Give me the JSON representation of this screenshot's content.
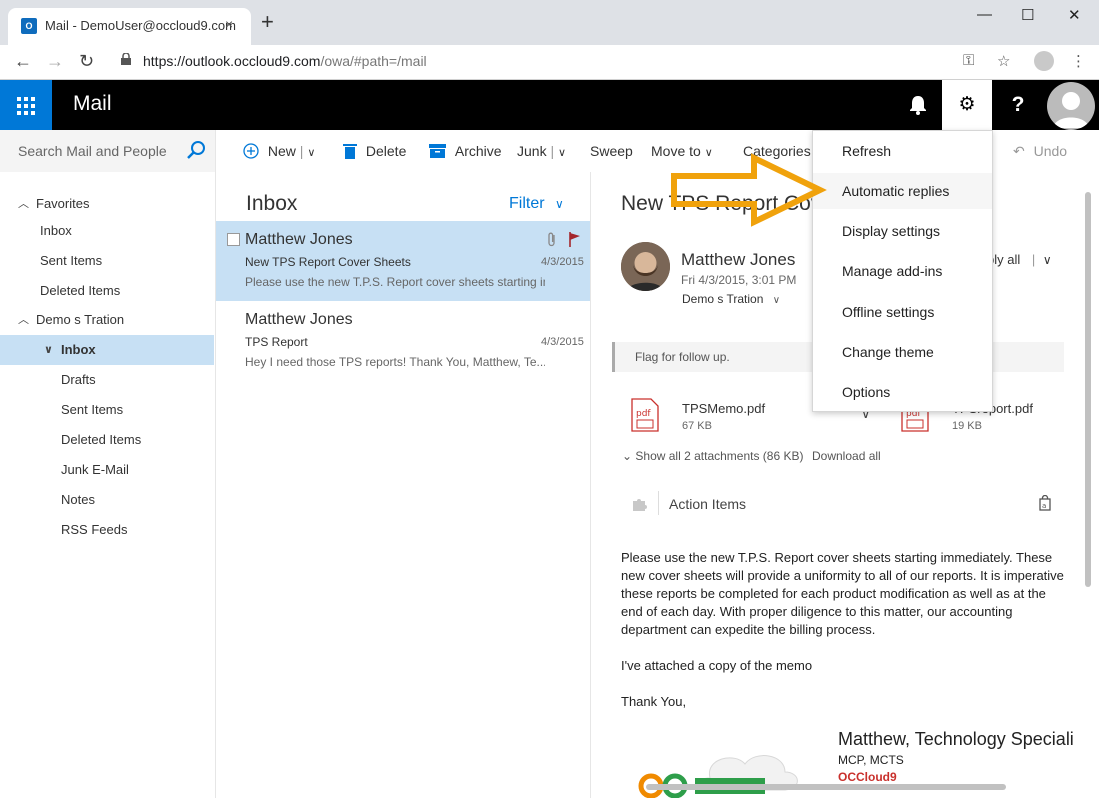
{
  "browser": {
    "tab_title": "Mail - DemoUser@occloud9.com",
    "tab_close": "×",
    "new_tab": "+",
    "favicon_letter": "O",
    "url_host": "https://outlook.occloud9.com",
    "url_path": "/owa/#path=/mail",
    "win_min": "—",
    "win_max": "☐",
    "win_close": "✕",
    "back": "←",
    "forward": "→",
    "reload": "↻",
    "key_icon": "⚿",
    "star_icon": "☆",
    "menu_icon": "⋮"
  },
  "app": {
    "title": "Mail",
    "bell_icon": "🔔",
    "settings_icon": "⚙",
    "help_icon": "?"
  },
  "leftnav": {
    "search_placeholder": "Search Mail and People",
    "favorites_label": "Favorites",
    "favorites": [
      "Inbox",
      "Sent Items",
      "Deleted Items"
    ],
    "account_label": "Demo s Tration",
    "folders": [
      "Inbox",
      "Drafts",
      "Sent Items",
      "Deleted Items",
      "Junk E-Mail",
      "Notes",
      "RSS Feeds"
    ]
  },
  "toolbar": {
    "new": "New",
    "delete": "Delete",
    "archive": "Archive",
    "junk": "Junk",
    "sweep": "Sweep",
    "move_to": "Move to",
    "categories": "Categories",
    "undo": "Undo",
    "sep": "|"
  },
  "messages": {
    "title": "Inbox",
    "filter": "Filter",
    "items": [
      {
        "from": "Matthew Jones",
        "subject": "New TPS Report Cover Sheets",
        "date": "4/3/2015",
        "preview": "Please use the new T.P.S. Report cover sheets starting im..."
      },
      {
        "from": "Matthew Jones",
        "subject": "TPS Report",
        "date": "4/3/2015",
        "preview": "Hey I need those TPS reports!   Thank You,    Matthew, Te..."
      }
    ]
  },
  "reading": {
    "subject": "New TPS Report Cov",
    "sender": "Matthew Jones",
    "sent": "Fri 4/3/2015, 3:01 PM",
    "to": "Demo s Tration",
    "reply_all": "ply all",
    "flag_text": "Flag for follow up.",
    "attachments": [
      {
        "name": "TPSMemo.pdf",
        "size": "67 KB"
      },
      {
        "name": "TPSreport.pdf",
        "size": "19 KB"
      }
    ],
    "show_all": "Show all 2 attachments (86 KB)",
    "download_all": "Download all",
    "action_items": "Action Items",
    "body_p1": "Please use the new T.P.S. Report cover sheets starting immediately. These new cover sheets will provide a uniformity to all of our reports. It is imperative these reports be completed for each product modification as well as at the end of each day. With proper diligence to this matter, our accounting department can expedite the billing process.",
    "body_p2": "I've attached a copy of the memo",
    "body_p3": "Thank You,",
    "sig_name": "Matthew, Technology Speciali",
    "sig_cert": "MCP, MCTS",
    "sig_org": "OCCloud9"
  },
  "settings_menu": {
    "items": [
      "Refresh",
      "Automatic replies",
      "Display settings",
      "Manage add-ins",
      "Offline settings",
      "Change theme",
      "Options"
    ]
  },
  "colors": {
    "accent": "#0078d7",
    "header": "#000000",
    "selected": "#c7e0f4",
    "arrow": "#f0a20c"
  }
}
